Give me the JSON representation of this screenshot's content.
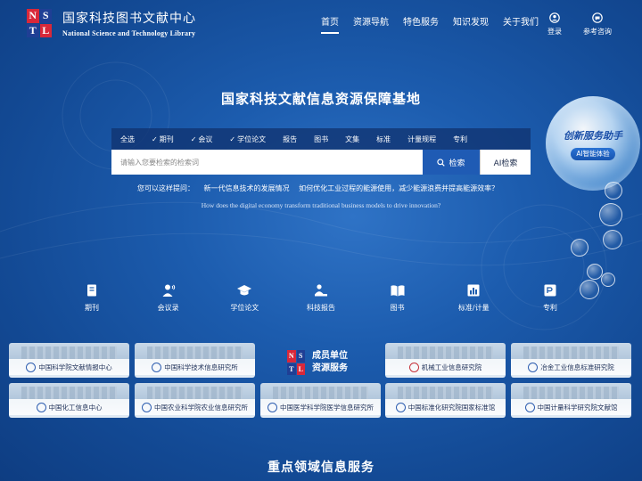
{
  "header": {
    "logo_letters": [
      "N",
      "S",
      "T",
      "L"
    ],
    "title_cn": "国家科技图书文献中心",
    "title_en": "National Science and Technology Library",
    "nav": [
      "首页",
      "资源导航",
      "特色服务",
      "知识发现",
      "关于我们"
    ],
    "login": "登录",
    "consult": "参考咨询"
  },
  "hero": {
    "title": "国家科技文献信息资源保障基地",
    "types": [
      {
        "label": "全选",
        "checked": false
      },
      {
        "label": "期刊",
        "checked": true
      },
      {
        "label": "会议",
        "checked": true
      },
      {
        "label": "学位论文",
        "checked": true
      },
      {
        "label": "报告",
        "checked": false
      },
      {
        "label": "图书",
        "checked": false
      },
      {
        "label": "文集",
        "checked": false
      },
      {
        "label": "标准",
        "checked": false
      },
      {
        "label": "计量规程",
        "checked": false
      },
      {
        "label": "专利",
        "checked": false
      }
    ],
    "search_placeholder": "请输入您要检索的检索词",
    "search_button": "检索",
    "ai_button": "AI检索",
    "suggest_label": "您可以这样提问：",
    "suggest_1": "新一代信息技术的发展情况",
    "suggest_2": "如何优化工业过程的能源使用，减少能源浪费并提高能源效率？",
    "suggest_en": "How does the digital economy transform traditional business models to drive innovation?"
  },
  "assistant": {
    "title": "创新服务助手",
    "badge": "AI智能体验"
  },
  "categories": [
    "期刊",
    "会议录",
    "学位论文",
    "科技报告",
    "图书",
    "标准/计量",
    "专利"
  ],
  "members": {
    "center_line1": "成员单位",
    "center_line2": "资源服务",
    "row1": [
      "中国科学院文献情报中心",
      "中国科学技术信息研究所",
      "机械工业信息研究院",
      "冶金工业信息标准研究院"
    ],
    "row2": [
      "中国化工信息中心",
      "中国农业科学院农业信息研究所",
      "中国医学科学院医学信息研究所",
      "中国标准化研究院国家标准馆",
      "中国计量科学研究院文献馆"
    ]
  },
  "section_title": "重点领域信息服务"
}
